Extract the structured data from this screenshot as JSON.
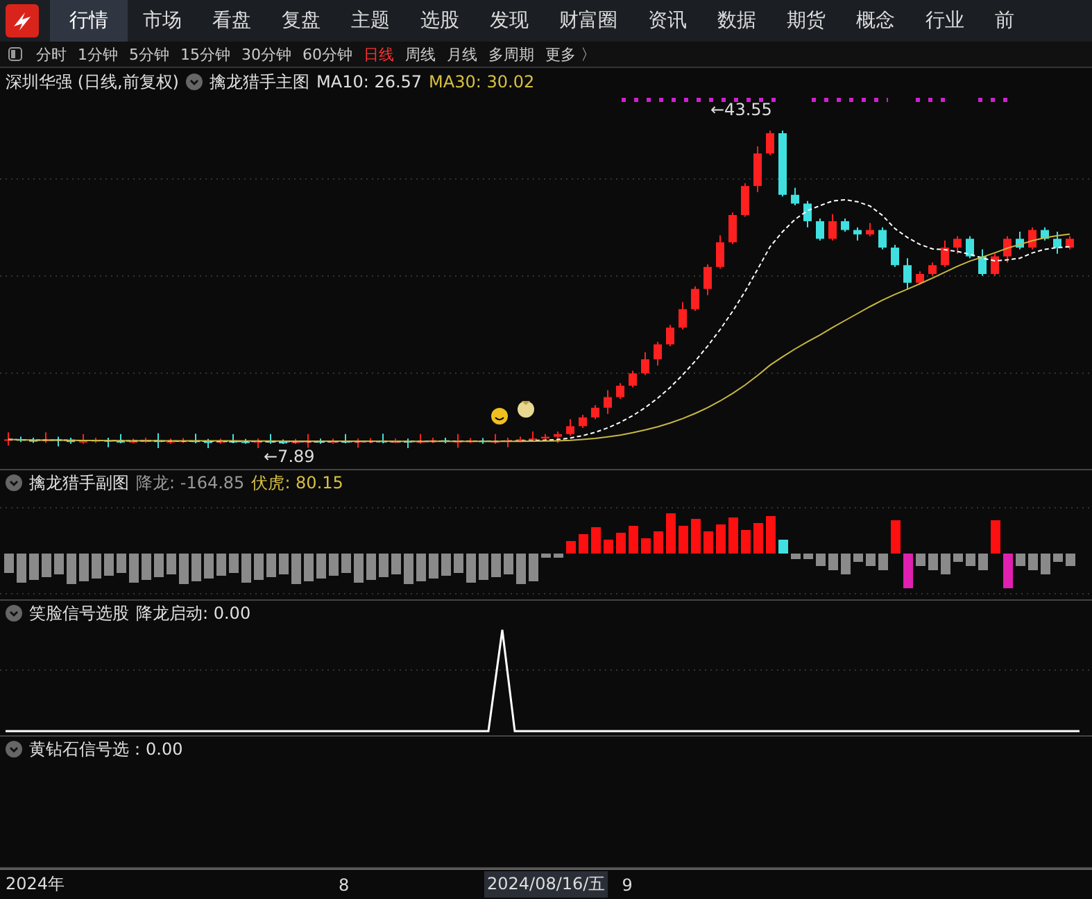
{
  "nav": {
    "tabs": [
      {
        "label": "行情",
        "selected": true
      },
      {
        "label": "市场",
        "selected": false
      },
      {
        "label": "看盘",
        "selected": false
      },
      {
        "label": "复盘",
        "selected": false
      },
      {
        "label": "主题",
        "selected": false
      },
      {
        "label": "选股",
        "selected": false
      },
      {
        "label": "发现",
        "selected": false
      },
      {
        "label": "财富圈",
        "selected": false
      },
      {
        "label": "资讯",
        "selected": false
      },
      {
        "label": "数据",
        "selected": false
      },
      {
        "label": "期货",
        "selected": false
      },
      {
        "label": "概念",
        "selected": false
      },
      {
        "label": "行业",
        "selected": false
      },
      {
        "label": "前",
        "selected": false
      }
    ]
  },
  "periods": [
    {
      "label": "分时",
      "selected": false
    },
    {
      "label": "1分钟",
      "selected": false
    },
    {
      "label": "5分钟",
      "selected": false
    },
    {
      "label": "15分钟",
      "selected": false
    },
    {
      "label": "30分钟",
      "selected": false
    },
    {
      "label": "60分钟",
      "selected": false
    },
    {
      "label": "日线",
      "selected": true
    },
    {
      "label": "周线",
      "selected": false
    },
    {
      "label": "月线",
      "selected": false
    },
    {
      "label": "多周期",
      "selected": false
    },
    {
      "label": "更多 〉",
      "selected": false
    }
  ],
  "main_chart": {
    "title": "深圳华强 (日线,前复权)",
    "indicator": "擒龙猎手主图",
    "ma10": "MA10: 26.57",
    "ma30": "MA30: 30.02",
    "high_label": "←43.55",
    "low_label": "←7.89"
  },
  "sub_chart": {
    "indicator": "擒龙猎手副图",
    "value_1": "降龙: -164.85",
    "value_2": "伏虎: 80.15"
  },
  "signal_panel": {
    "indicator": "笑脸信号选股",
    "value": "降龙启动: 0.00"
  },
  "diamond_panel": {
    "indicator": "黄钻石信号选：0.00"
  },
  "time_axis": {
    "labels": [
      "2024年",
      "8"
    ],
    "cursor_date": "2024/08/16/五",
    "labels_after": [
      "9"
    ]
  }
}
